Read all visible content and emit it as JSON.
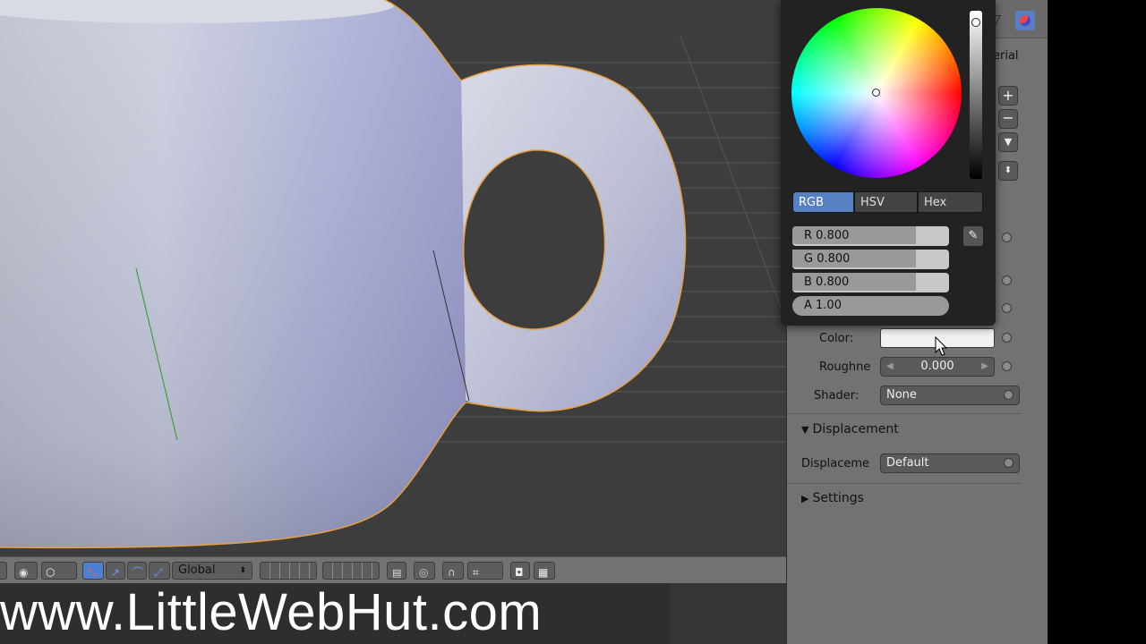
{
  "color_picker": {
    "tabs": [
      "RGB",
      "HSV",
      "Hex"
    ],
    "active_tab": "RGB",
    "r_label": "R 0.800",
    "g_label": "G 0.800",
    "b_label": "B 0.800",
    "a_label": "A 1.00",
    "r_value": 0.8,
    "g_value": 0.8,
    "b_value": 0.8,
    "a_value": 1.0
  },
  "properties": {
    "header_partial": "erial",
    "color_label": "Color:",
    "roughness_label": "Roughne",
    "roughness_value": "0.000",
    "shader_label": "Shader:",
    "shader_value": "None",
    "displacement_panel": "Displacement",
    "displacement_label": "Displaceme",
    "displacement_value": "Default",
    "settings_panel": "Settings"
  },
  "toolbar": {
    "orientation_value": "Global"
  },
  "watermark": "www.LittleWebHut.com",
  "colors": {
    "active_tab": "#5680c2",
    "viewport_bg": "#3d3d3d",
    "selection_outline": "#e8a040",
    "panel_bg": "#727272"
  }
}
